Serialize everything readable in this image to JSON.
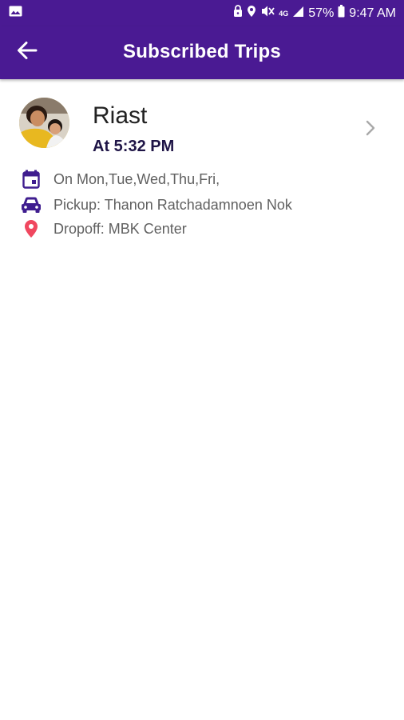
{
  "status_bar": {
    "battery": "57%",
    "time": "9:47 AM",
    "network": "4G",
    "icons": [
      "image-icon",
      "lock-icon",
      "location-icon",
      "mute-icon",
      "signal-icon",
      "battery-icon"
    ]
  },
  "app_bar": {
    "title": "Subscribed Trips",
    "back_icon": "arrow-left-icon"
  },
  "trip": {
    "name": "Riast",
    "time": "At 5:32 PM",
    "days": "On Mon,Tue,Wed,Thu,Fri,",
    "pickup": "Pickup: Thanon Ratchadamnoen Nok",
    "dropoff": "Dropoff: MBK Center"
  },
  "colors": {
    "brand": "#4a1a93",
    "icon_purple": "#3f1d8f",
    "pin_red": "#f0475f",
    "time_text": "#1e1446",
    "detail_text": "#606060"
  }
}
